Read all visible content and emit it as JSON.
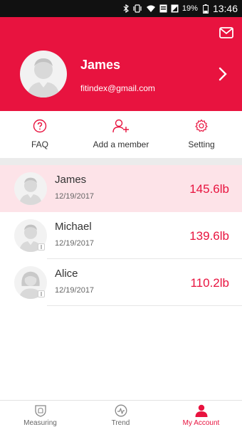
{
  "status_bar": {
    "battery": "19%",
    "time": "13:46"
  },
  "header": {
    "name": "James",
    "email": "fitindex@gmail.com"
  },
  "actions": [
    {
      "label": "FAQ",
      "icon": "question-circle-icon"
    },
    {
      "label": "Add a member",
      "icon": "add-person-icon"
    },
    {
      "label": "Setting",
      "icon": "gear-icon"
    }
  ],
  "members": [
    {
      "name": "James",
      "date": "12/19/2017",
      "weight": "145.6lb",
      "active": true
    },
    {
      "name": "Michael",
      "date": "12/19/2017",
      "weight": "139.6lb",
      "active": false
    },
    {
      "name": "Alice",
      "date": "12/19/2017",
      "weight": "110.2lb",
      "active": false
    }
  ],
  "tabs": [
    {
      "label": "Measuring",
      "icon": "shield-icon"
    },
    {
      "label": "Trend",
      "icon": "trend-icon"
    },
    {
      "label": "My Account",
      "icon": "person-icon",
      "selected": true
    }
  ],
  "colors": {
    "accent": "#e8133f",
    "active_row": "#fde3e8"
  }
}
